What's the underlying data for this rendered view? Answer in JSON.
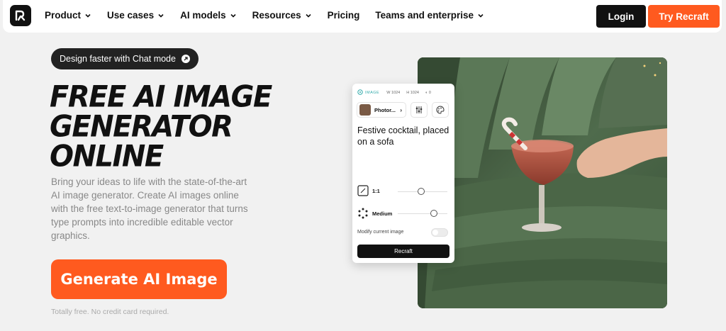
{
  "nav": {
    "logo_icon": "recraft-logo-icon",
    "items": [
      {
        "label": "Product",
        "has_dropdown": true
      },
      {
        "label": "Use cases",
        "has_dropdown": true
      },
      {
        "label": "AI models",
        "has_dropdown": true
      },
      {
        "label": "Resources",
        "has_dropdown": true
      },
      {
        "label": "Pricing",
        "has_dropdown": false
      },
      {
        "label": "Teams and enterprise",
        "has_dropdown": true
      }
    ],
    "login_label": "Login",
    "try_label": "Try Recraft"
  },
  "hero": {
    "pill_label": "Design faster with Chat mode",
    "title_lines": [
      "FREE AI IMAGE",
      "GENERATOR",
      "ONLINE"
    ],
    "description": "Bring your ideas to life with the state-of-the-art AI image generator. Create AI images online with the free text-to-image generator that turns type prompts into incredible editable vector graphics.",
    "cta_label": "Generate AI Image",
    "note": "Totally free. No credit card required."
  },
  "panel": {
    "mode_label": "IMAGE",
    "width": "1024",
    "height": "1024",
    "count": "0",
    "style_label": "Photor...",
    "prompt": "Festive cocktail, placed on a sofa",
    "aspect_label": "1:1",
    "quality_label": "Medium",
    "modify_label": "Modify current image",
    "modify_enabled": false,
    "submit_label": "Recraft"
  },
  "colors": {
    "accent": "#ff5a1f",
    "dark": "#111111",
    "background": "#f1f1f1",
    "muted_text": "#888888"
  }
}
